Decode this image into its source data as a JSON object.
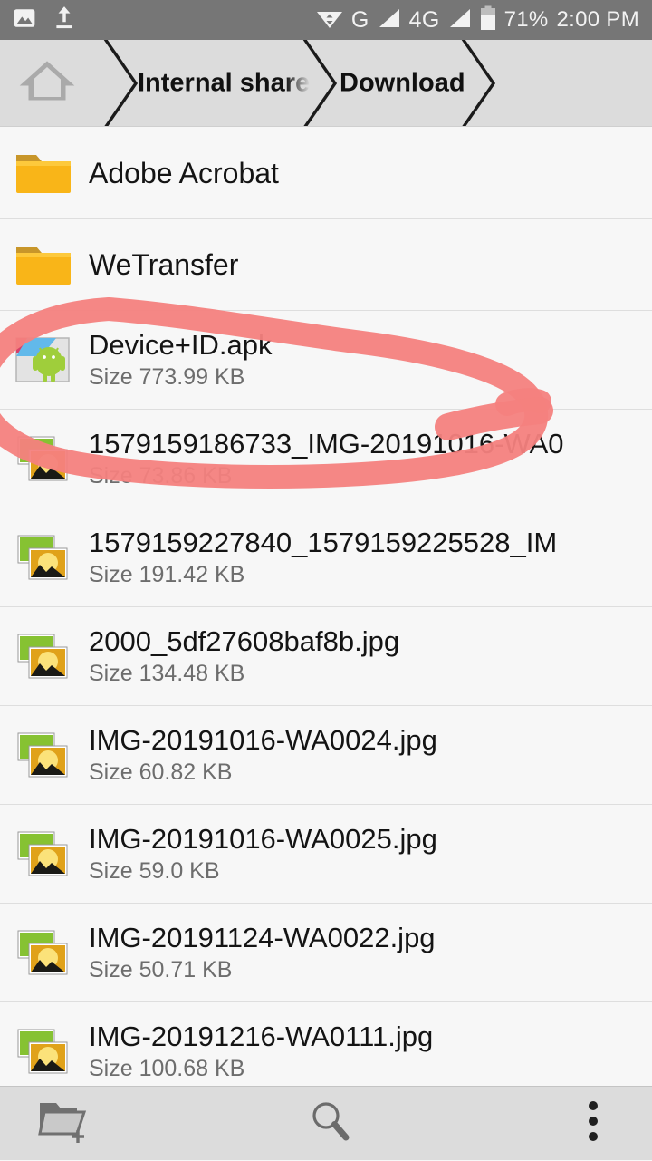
{
  "statusbar": {
    "left_icons": [
      {
        "name": "photo-icon",
        "label": "image"
      },
      {
        "name": "upload-icon",
        "label": "upload"
      }
    ],
    "wifi_icon": "wifi-data-icon",
    "network_g": "G",
    "network_4g": "4G",
    "signal_icon_1": "signal-bars-icon",
    "signal_icon_2": "signal-bars-icon",
    "battery_icon": "battery-icon",
    "battery": "71%",
    "time": "2:00 PM"
  },
  "breadcrumb": {
    "home_icon": "home-icon",
    "items": [
      {
        "label": "Internal shared",
        "truncated": true
      },
      {
        "label": "Download",
        "truncated": false
      }
    ]
  },
  "files": [
    {
      "name": "Adobe Acrobat",
      "size": "",
      "type": "folder",
      "icon": "folder-icon",
      "clipped": false
    },
    {
      "name": "WeTransfer",
      "size": "",
      "type": "folder",
      "icon": "folder-icon",
      "clipped": false
    },
    {
      "name": "Device+ID.apk",
      "size": "Size 773.99 KB",
      "type": "apk",
      "icon": "apk-icon",
      "clipped": false
    },
    {
      "name": "1579159186733_IMG-20191016-WA0",
      "size": "Size 73.86 KB",
      "type": "image",
      "icon": "image-icon",
      "clipped": true
    },
    {
      "name": "1579159227840_1579159225528_IM",
      "size": "Size 191.42 KB",
      "type": "image",
      "icon": "image-icon",
      "clipped": true
    },
    {
      "name": "2000_5df27608baf8b.jpg",
      "size": "Size 134.48 KB",
      "type": "image",
      "icon": "image-icon",
      "clipped": false
    },
    {
      "name": "IMG-20191016-WA0024.jpg",
      "size": "Size 60.82 KB",
      "type": "image",
      "icon": "image-icon",
      "clipped": false
    },
    {
      "name": "IMG-20191016-WA0025.jpg",
      "size": "Size 59.0 KB",
      "type": "image",
      "icon": "image-icon",
      "clipped": false
    },
    {
      "name": "IMG-20191124-WA0022.jpg",
      "size": "Size 50.71 KB",
      "type": "image",
      "icon": "image-icon",
      "clipped": false
    },
    {
      "name": "IMG-20191216-WA0111.jpg",
      "size": "Size 100.68 KB",
      "type": "image",
      "icon": "image-icon",
      "clipped": false
    }
  ],
  "annotation": {
    "shape": "hand-drawn-ellipse-with-tail",
    "color": "#f4817e",
    "target": "Device+ID.apk"
  },
  "bottombar": {
    "new_folder_icon": "new-folder-icon",
    "search_icon": "search-icon",
    "overflow_icon": "overflow-menu-icon"
  },
  "colors": {
    "statusbar_bg": "#767676",
    "chrome_bg": "#dcdcdc",
    "list_bg": "#f7f7f7",
    "separator": "#dedede",
    "annotation_red": "#f4817e",
    "folder_yellow": "#f5b721"
  }
}
